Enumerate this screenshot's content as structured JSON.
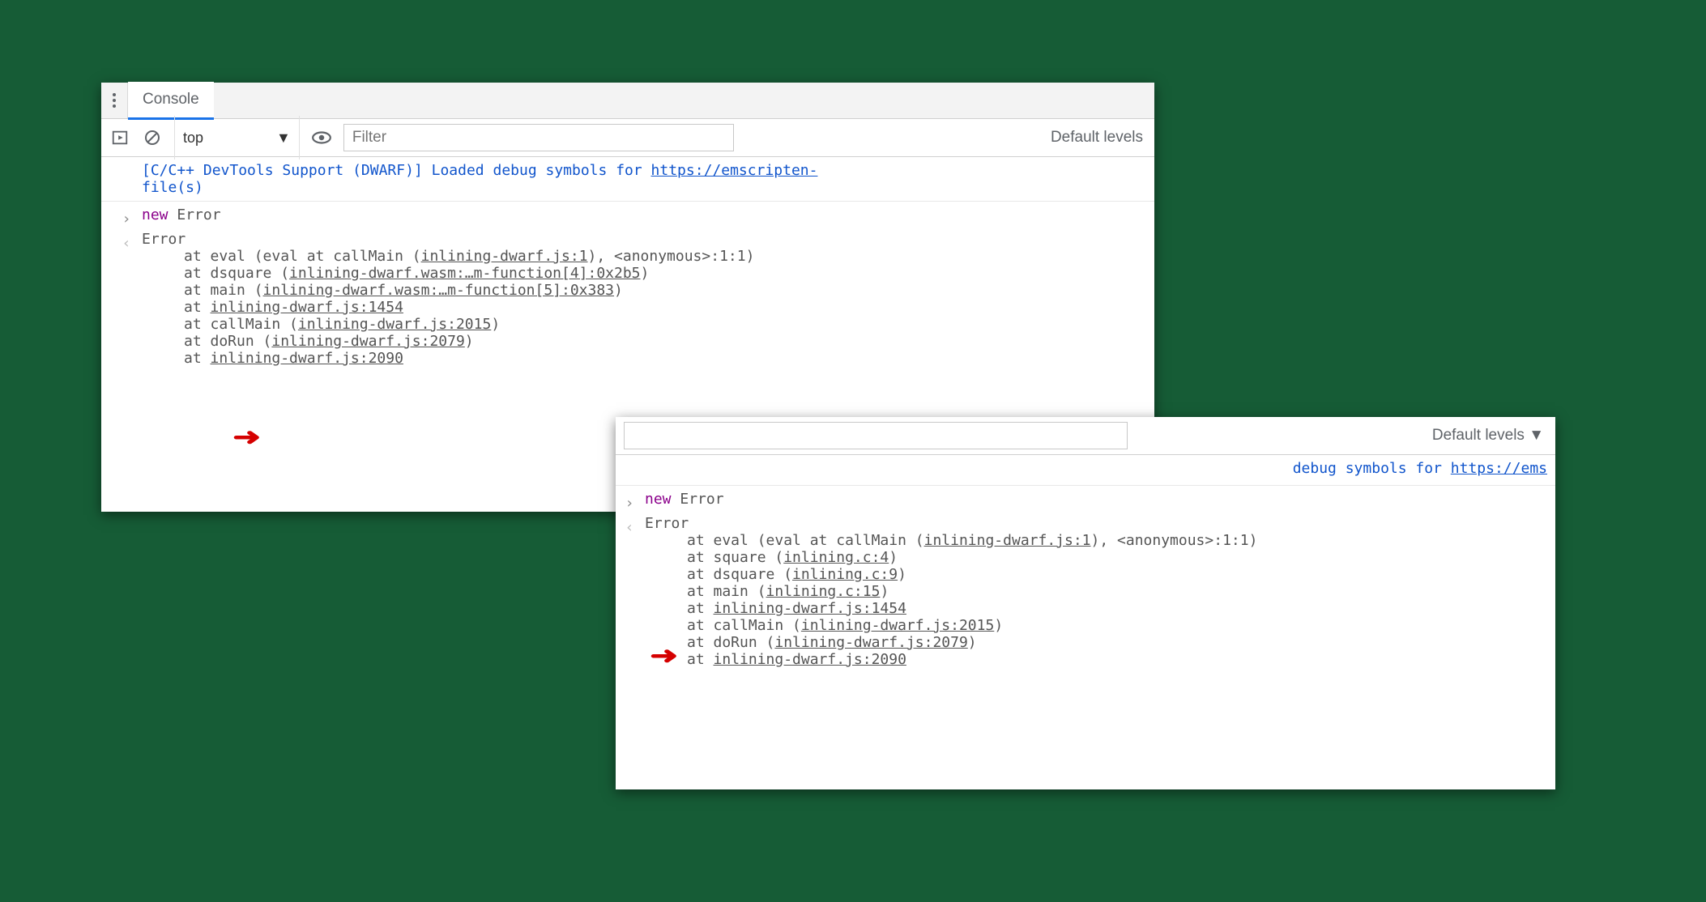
{
  "panel1": {
    "tab_console": "Console",
    "context": "top",
    "filter_placeholder": "Filter",
    "levels": "Default levels",
    "msg_prefix": "[C/C++ DevTools Support (DWARF)] Loaded debug symbols for ",
    "msg_link": "https://emscripten-",
    "msg_line2": "file(s)",
    "input_new": "new",
    "input_error": "Error",
    "out_error": "Error",
    "stack": {
      "l1_a": "at eval (eval at callMain (",
      "l1_link": "inlining-dwarf.js:1",
      "l1_b": "), <anonymous>:1:1)",
      "l2_a": "at dsquare (",
      "l2_link": "inlining-dwarf.wasm:…m-function[4]:0x2b5",
      "l2_b": ")",
      "l3_a": "at main (",
      "l3_link": "inlining-dwarf.wasm:…m-function[5]:0x383",
      "l3_b": ")",
      "l4_a": "at ",
      "l4_link": "inlining-dwarf.js:1454",
      "l5_a": "at callMain (",
      "l5_link": "inlining-dwarf.js:2015",
      "l5_b": ")",
      "l6_a": "at doRun (",
      "l6_link": "inlining-dwarf.js:2079",
      "l6_b": ")",
      "l7_a": "at ",
      "l7_link": "inlining-dwarf.js:2090"
    }
  },
  "panel2": {
    "levels": "Default levels ▼",
    "msg_a": "debug symbols for ",
    "msg_link": "https://ems",
    "input_new": "new",
    "input_error": "Error",
    "out_error": "Error",
    "stack": {
      "l1_a": "at eval (eval at callMain (",
      "l1_link": "inlining-dwarf.js:1",
      "l1_b": "), <anonymous>:1:1)",
      "l2_a": "at square (",
      "l2_link": "inlining.c:4",
      "l2_b": ")",
      "l3_a": "at dsquare (",
      "l3_link": "inlining.c:9",
      "l3_b": ")",
      "l4_a": "at main (",
      "l4_link": "inlining.c:15",
      "l4_b": ")",
      "l5_a": "at ",
      "l5_link": "inlining-dwarf.js:1454",
      "l6_a": "at callMain (",
      "l6_link": "inlining-dwarf.js:2015",
      "l6_b": ")",
      "l7_a": "at doRun (",
      "l7_link": "inlining-dwarf.js:2079",
      "l7_b": ")",
      "l8_a": "at ",
      "l8_link": "inlining-dwarf.js:2090"
    }
  }
}
